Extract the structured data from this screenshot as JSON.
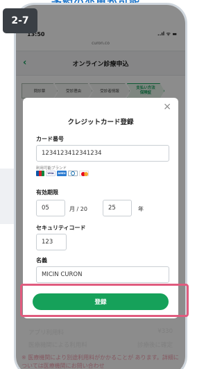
{
  "heading": "予約の変更が可能",
  "badge": "2-7",
  "status": {
    "time": "13:50",
    "icons": "..ıl ᯤ ▬"
  },
  "url": "curon.co",
  "header": {
    "title": "オンライン診療申込"
  },
  "steps": [
    "問診票",
    "受診理由",
    "受診者情報",
    "支払い方法\n保険証"
  ],
  "modal": {
    "title": "クレジットカード登録",
    "card_number_label": "カード番号",
    "card_number_value": "1234123412341234",
    "brands_label": "利用可能ブランド",
    "brands": [
      "JCB",
      "VISA",
      "AMEX",
      "Diners",
      "Mastercard"
    ],
    "expiry_label": "有効期限",
    "expiry_month": "05",
    "expiry_sep": "月 / 20",
    "expiry_year": "25",
    "expiry_year_suffix": "年",
    "cvc_label": "セキュリティコード",
    "cvc_value": "123",
    "name_label": "名義",
    "name_value": "MICIN CURON",
    "register_label": "登録"
  },
  "fees": [
    {
      "label": "アプリ利用料",
      "value": "¥330"
    },
    {
      "label": "医療機関による利用料",
      "value": "診療後に確定"
    }
  ],
  "notice": "※ 医療機関により別途利用料がかかることが あります。詳細については医療機関にお問い合わせ",
  "colors": {
    "accent": "#16a15a",
    "highlight": "#e05b7e",
    "heading": "#1a73c9"
  }
}
